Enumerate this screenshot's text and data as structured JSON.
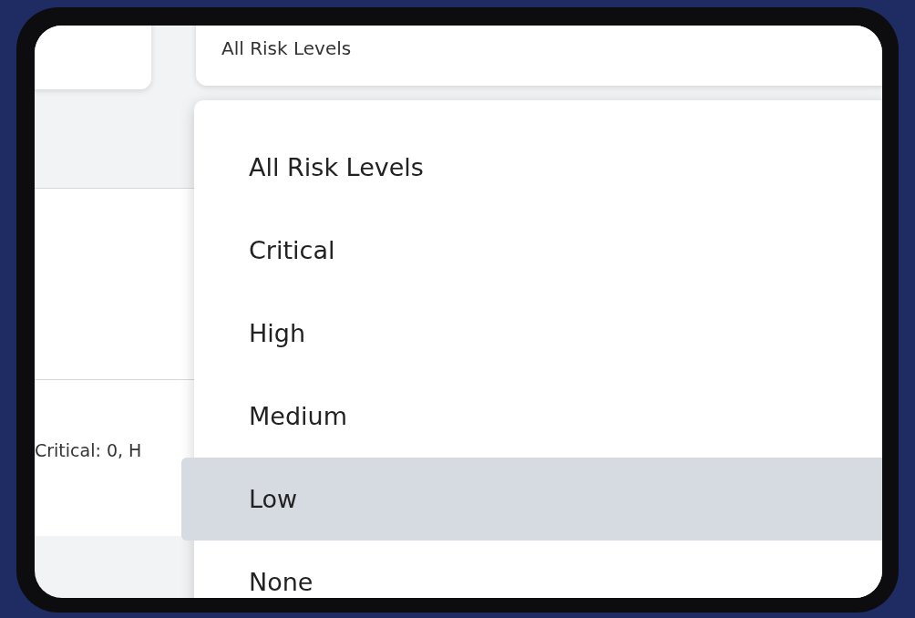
{
  "filter": {
    "value": "All Risk Levels"
  },
  "dropdown": {
    "options": [
      {
        "label": "All Risk Levels",
        "selected": false
      },
      {
        "label": "Critical",
        "selected": false
      },
      {
        "label": "High",
        "selected": false
      },
      {
        "label": "Medium",
        "selected": false
      },
      {
        "label": "Low",
        "selected": true
      },
      {
        "label": "None",
        "selected": false
      }
    ]
  },
  "summary": {
    "text": "Critical: 0, H"
  }
}
